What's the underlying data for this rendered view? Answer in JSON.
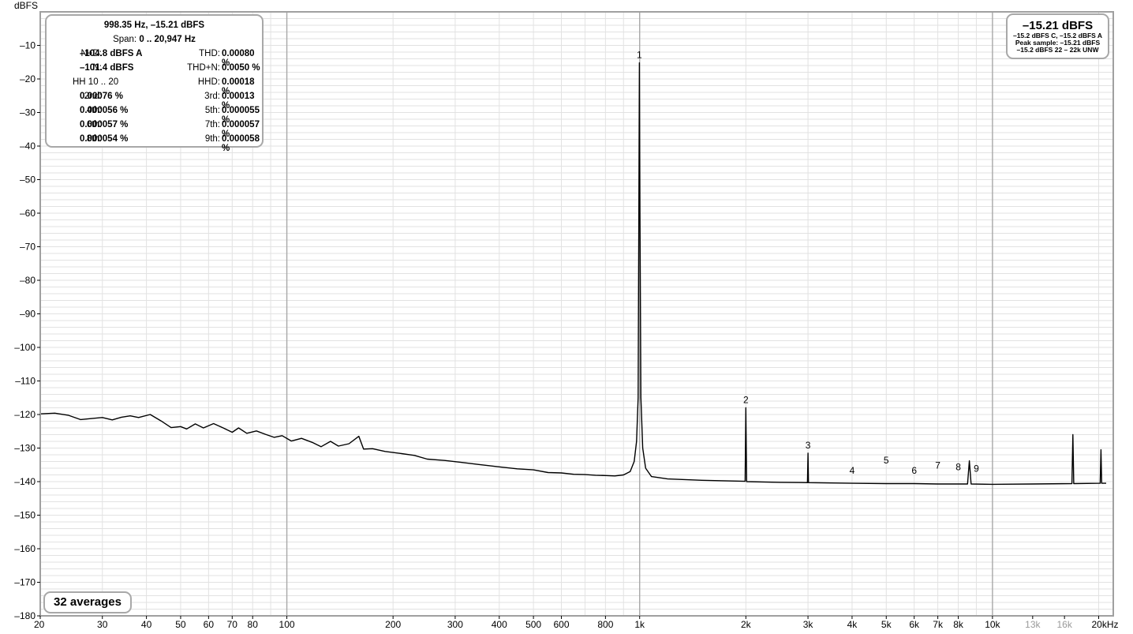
{
  "chart_data": {
    "type": "line",
    "x_scale": "log",
    "xlim": [
      20,
      22000
    ],
    "ylim": [
      -180,
      0
    ],
    "ylabel": "dBFS",
    "xticks": [
      {
        "v": 20,
        "label": "20"
      },
      {
        "v": 30,
        "label": "30"
      },
      {
        "v": 40,
        "label": "40"
      },
      {
        "v": 50,
        "label": "50"
      },
      {
        "v": 60,
        "label": "60"
      },
      {
        "v": 70,
        "label": "70"
      },
      {
        "v": 80,
        "label": "80"
      },
      {
        "v": 100,
        "label": "100"
      },
      {
        "v": 200,
        "label": "200"
      },
      {
        "v": 300,
        "label": "300"
      },
      {
        "v": 400,
        "label": "400"
      },
      {
        "v": 500,
        "label": "500"
      },
      {
        "v": 600,
        "label": "600"
      },
      {
        "v": 800,
        "label": "800"
      },
      {
        "v": 1000,
        "label": "1k"
      },
      {
        "v": 2000,
        "label": "2k"
      },
      {
        "v": 3000,
        "label": "3k"
      },
      {
        "v": 4000,
        "label": "4k"
      },
      {
        "v": 5000,
        "label": "5k"
      },
      {
        "v": 6000,
        "label": "6k"
      },
      {
        "v": 7000,
        "label": "7k"
      },
      {
        "v": 8000,
        "label": "8k"
      },
      {
        "v": 10000,
        "label": "10k"
      },
      {
        "v": 13000,
        "label": "13k"
      },
      {
        "v": 16000,
        "label": "16k"
      },
      {
        "v": 20000,
        "label": "20kHz"
      }
    ],
    "yticks": [
      -10,
      -20,
      -30,
      -40,
      -50,
      -60,
      -70,
      -80,
      -90,
      -100,
      -110,
      -120,
      -130,
      -140,
      -150,
      -160,
      -170,
      -180
    ],
    "grid": true,
    "series": [
      {
        "color": "#000000",
        "points": [
          [
            20,
            -119.8
          ],
          [
            22,
            -119.6
          ],
          [
            24,
            -120.2
          ],
          [
            26,
            -121.5
          ],
          [
            28,
            -121.2
          ],
          [
            30,
            -120.9
          ],
          [
            32,
            -121.6
          ],
          [
            34,
            -120.8
          ],
          [
            36,
            -120.4
          ],
          [
            38,
            -120.9
          ],
          [
            41,
            -120.0
          ],
          [
            44,
            -121.9
          ],
          [
            47,
            -123.9
          ],
          [
            50,
            -123.6
          ],
          [
            52,
            -124.3
          ],
          [
            55,
            -122.8
          ],
          [
            58,
            -124.0
          ],
          [
            62,
            -122.7
          ],
          [
            66,
            -124.0
          ],
          [
            70,
            -125.3
          ],
          [
            73,
            -124.0
          ],
          [
            77,
            -125.6
          ],
          [
            82,
            -124.9
          ],
          [
            87,
            -125.9
          ],
          [
            92,
            -126.8
          ],
          [
            97,
            -126.3
          ],
          [
            103,
            -127.9
          ],
          [
            110,
            -127.1
          ],
          [
            118,
            -128.3
          ],
          [
            125,
            -129.6
          ],
          [
            133,
            -128.0
          ],
          [
            140,
            -129.4
          ],
          [
            150,
            -128.7
          ],
          [
            160,
            -126.5
          ],
          [
            165,
            -130.3
          ],
          [
            175,
            -130.2
          ],
          [
            190,
            -131.0
          ],
          [
            210,
            -131.6
          ],
          [
            230,
            -132.2
          ],
          [
            250,
            -133.3
          ],
          [
            280,
            -133.7
          ],
          [
            310,
            -134.2
          ],
          [
            350,
            -134.9
          ],
          [
            400,
            -135.6
          ],
          [
            450,
            -136.2
          ],
          [
            500,
            -136.5
          ],
          [
            550,
            -137.3
          ],
          [
            600,
            -137.4
          ],
          [
            650,
            -137.8
          ],
          [
            700,
            -137.9
          ],
          [
            750,
            -138.1
          ],
          [
            800,
            -138.2
          ],
          [
            850,
            -138.3
          ],
          [
            900,
            -138.0
          ],
          [
            940,
            -137.0
          ],
          [
            965,
            -134.0
          ],
          [
            980,
            -128.0
          ],
          [
            990,
            -115.0
          ],
          [
            995,
            -60.0
          ],
          [
            998.35,
            -15.21
          ],
          [
            1002,
            -60.0
          ],
          [
            1008,
            -115.0
          ],
          [
            1020,
            -130.0
          ],
          [
            1040,
            -136.0
          ],
          [
            1080,
            -138.5
          ],
          [
            1200,
            -139.2
          ],
          [
            1500,
            -139.6
          ],
          [
            1990,
            -139.9
          ],
          [
            2000,
            -118.0
          ],
          [
            2010,
            -140.0
          ],
          [
            2500,
            -140.2
          ],
          [
            2990,
            -140.3
          ],
          [
            3000,
            -131.5
          ],
          [
            3010,
            -140.3
          ],
          [
            4000,
            -140.5
          ],
          [
            5000,
            -140.6
          ],
          [
            6000,
            -140.6
          ],
          [
            7000,
            -140.7
          ],
          [
            8500,
            -140.7
          ],
          [
            8600,
            -133.8
          ],
          [
            8700,
            -140.7
          ],
          [
            10000,
            -140.8
          ],
          [
            13000,
            -140.7
          ],
          [
            16800,
            -140.6
          ],
          [
            16900,
            -126.0
          ],
          [
            17000,
            -140.6
          ],
          [
            20200,
            -140.5
          ],
          [
            20300,
            -130.5
          ],
          [
            20400,
            -140.5
          ],
          [
            21000,
            -140.5
          ]
        ]
      }
    ],
    "harmonic_labels": [
      {
        "label": "1",
        "x": 998,
        "y": -15.2
      },
      {
        "label": "2",
        "x": 2000,
        "y": -118
      },
      {
        "label": "3",
        "x": 3000,
        "y": -131.5
      },
      {
        "label": "4",
        "x": 4000,
        "y": -139
      },
      {
        "label": "5",
        "x": 5000,
        "y": -136
      },
      {
        "label": "6",
        "x": 6000,
        "y": -139
      },
      {
        "label": "7",
        "x": 7000,
        "y": -137.5
      },
      {
        "label": "8",
        "x": 8000,
        "y": -138
      },
      {
        "label": "9",
        "x": 9000,
        "y": -138.5
      }
    ]
  },
  "summary": {
    "header1": "998.35 Hz, –15.21 dBFS",
    "header2_label": "Span:",
    "header2_value": "0 .. 20,947 Hz",
    "rows": [
      [
        "N+D:",
        "–104.8 dBFS A",
        "THD:",
        "0.00080 %"
      ],
      [
        "N:",
        "–101.4 dBFS",
        "THD+N:",
        "0.0050 %"
      ],
      [
        "HH 10 .. 20",
        "",
        "HHD:",
        "0.00018 %"
      ],
      [
        "2nd:",
        "0.00076 %",
        "3rd:",
        "0.00013 %"
      ],
      [
        "4th:",
        "0.000056 %",
        "5th:",
        "0.000055 %"
      ],
      [
        "6th:",
        "0.000057 %",
        "7th:",
        "0.000057 %"
      ],
      [
        "8th:",
        "0.000054 %",
        "9th:",
        "0.000058 %"
      ]
    ]
  },
  "level": {
    "main": "–15.21 dBFS",
    "line1": "–15.2 dBFS C, –15.2 dBFS A",
    "line2": "Peak sample: –15.21 dBFS",
    "line3": "–15.2 dBFS 22 – 22k UNW"
  },
  "averages": "32 averages",
  "colors": {
    "trace": "#000000",
    "grid_minor": "#e2e2e2",
    "grid_major": "#a8a8a8",
    "frame": "#a0a0a0"
  }
}
